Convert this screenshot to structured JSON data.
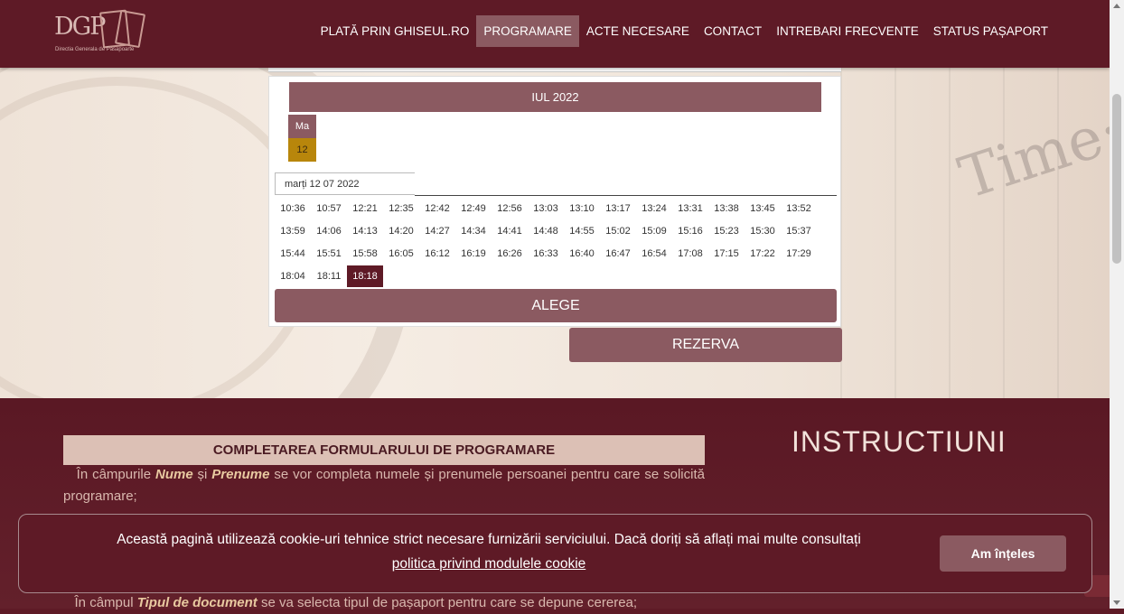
{
  "header": {
    "logo_text": "DGP",
    "logo_sub": "Directia Generala de Pasapoarte",
    "nav": [
      {
        "label": "PLATĂ PRIN GHISEUL.RO"
      },
      {
        "label": "PROGRAMARE"
      },
      {
        "label": "ACTE NECESARE"
      },
      {
        "label": "CONTACT"
      },
      {
        "label": "INTREBARI FRECVENTE"
      },
      {
        "label": "STATUS PAȘAPORT"
      }
    ],
    "active": "PROGRAMARE"
  },
  "calendar": {
    "month": "IUL 2022",
    "day_header": "Ma",
    "day": "12",
    "selected_date": "marți 12 07 2022",
    "slots": [
      "10:36",
      "10:57",
      "12:21",
      "12:35",
      "12:42",
      "12:49",
      "12:56",
      "13:03",
      "13:10",
      "13:17",
      "13:24",
      "13:31",
      "13:38",
      "13:45",
      "13:52",
      "13:59",
      "14:06",
      "14:13",
      "14:20",
      "14:27",
      "14:34",
      "14:41",
      "14:48",
      "14:55",
      "15:02",
      "15:09",
      "15:16",
      "15:23",
      "15:30",
      "15:37",
      "15:44",
      "15:51",
      "15:58",
      "16:05",
      "16:12",
      "16:19",
      "16:26",
      "16:33",
      "16:40",
      "16:47",
      "16:54",
      "17:08",
      "17:15",
      "17:22",
      "17:29",
      "18:04",
      "18:11",
      "18:18"
    ],
    "selected_slot": "18:18",
    "choose_label": "ALEGE",
    "reserve_label": "REZERVA"
  },
  "instructions": {
    "form_title": "COMPLETAREA FORMULARULUI DE PROGRAMARE",
    "para1_a": "În câmpurile ",
    "para1_b": "Nume",
    "para1_c": " și ",
    "para1_d": "Prenume",
    "para1_e": " se vor completa numele și prenumele persoanei pentru care se solicită programare;",
    "para3_a": "În câmpul ",
    "para3_b": "Tipul de document",
    "para3_c": " se va selecta tipul de pașaport pentru care se depune cererea;",
    "heading": "INSTRUCTIUNI"
  },
  "cookie": {
    "text": "Această pagină utilizează cookie-uri tehnice strict necesare furnizării serviciului. Dacă doriți să aflați mai multe consultați",
    "link": "politica privind modulele cookie",
    "button": "Am înțeles"
  },
  "colors": {
    "brand": "#5e1a26",
    "accent": "#8b5a61",
    "day_highlight": "#b8860b"
  }
}
